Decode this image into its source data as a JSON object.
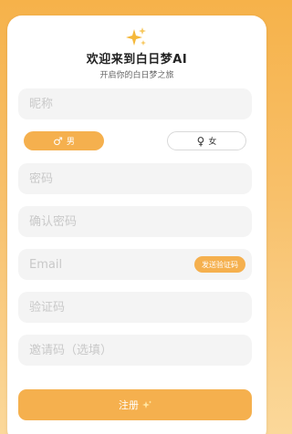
{
  "header": {
    "title": "欢迎来到白日梦AI",
    "subtitle": "开启你的白日梦之旅"
  },
  "form": {
    "nickname_placeholder": "昵称",
    "gender": {
      "male_label": "男",
      "female_label": "女",
      "male_symbol": "♂",
      "female_symbol": "♀",
      "selected": "male"
    },
    "password_placeholder": "密码",
    "confirm_password_placeholder": "确认密码",
    "email_placeholder": "Email",
    "send_code_label": "发送验证码",
    "verification_code_placeholder": "验证码",
    "invite_code_placeholder": "邀请码（选填）",
    "submit_label": "注册"
  },
  "colors": {
    "accent": "#f5b04e",
    "field_bg": "#f4f4f4",
    "background_top": "#f6b24a"
  },
  "icons": {
    "header_icon": "sparkles-icon",
    "submit_icon": "sparkle-icon"
  }
}
